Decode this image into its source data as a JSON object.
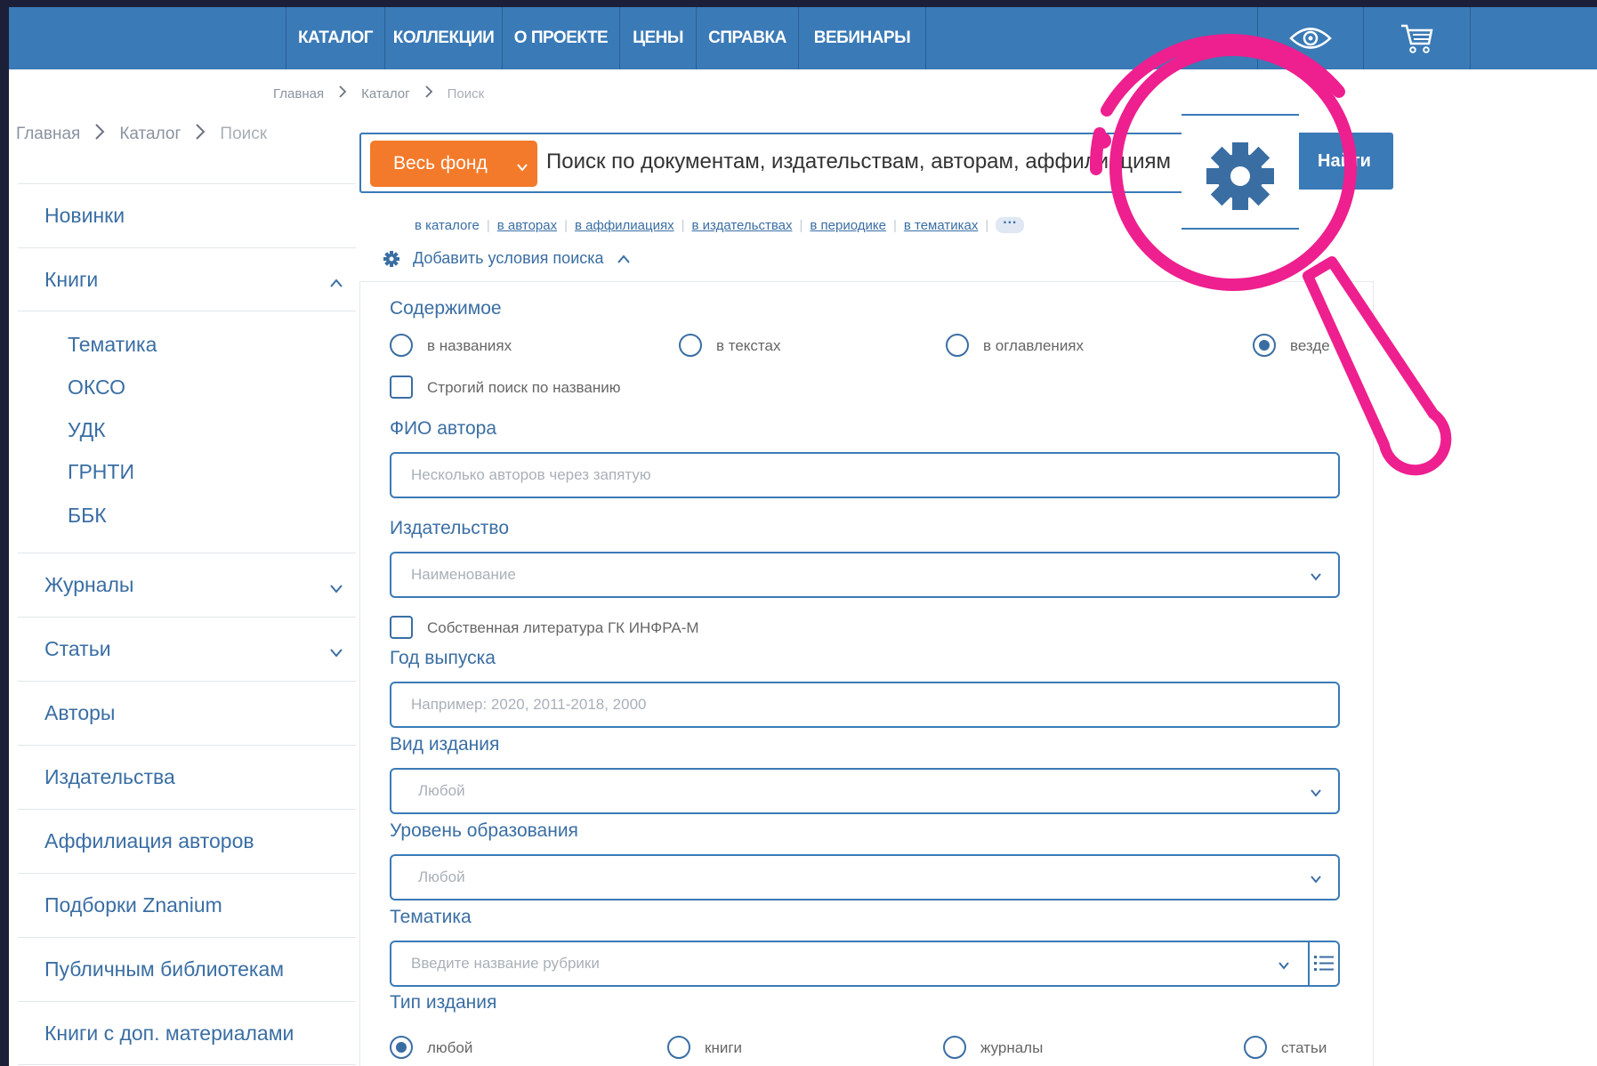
{
  "nav": {
    "items": [
      "КАТАЛОГ",
      "КОЛЛЕКЦИИ",
      "О ПРОЕКТЕ",
      "ЦЕНЫ",
      "СПРАВКА",
      "ВЕБИНАРЫ"
    ]
  },
  "breadcrumb_top": [
    "Главная",
    "Каталог",
    "Поиск"
  ],
  "breadcrumb_side": [
    "Главная",
    "Каталог",
    "Поиск"
  ],
  "sidebar": {
    "items": [
      "Новинки",
      "Книги",
      "Журналы",
      "Статьи",
      "Авторы",
      "Издательства",
      "Аффилиация авторов",
      "Подборки Znanium",
      "Публичным библиотекам",
      "Книги с доп. материалами"
    ],
    "sub_items": [
      "Тематика",
      "ОКСО",
      "УДК",
      "ГРНТИ",
      "ББК"
    ]
  },
  "search": {
    "fund_label": "Весь фонд",
    "placeholder": "Поиск по документам, издательствам, авторам, аффилиациям",
    "find_label": "Найти",
    "scopes": [
      "в каталоге",
      "в авторах",
      "в аффилиациях",
      "в издательствах",
      "в периодике",
      "в тематиках"
    ],
    "more": "···",
    "add_conditions": "Добавить условия поиска"
  },
  "form": {
    "content_label": "Содержимое",
    "content_options": [
      "в названиях",
      "в текстах",
      "в оглавлениях",
      "везде"
    ],
    "strict_label": "Строгий поиск по названию",
    "author_label": "ФИО автора",
    "author_placeholder": "Несколько авторов через запятую",
    "publisher_label": "Издательство",
    "publisher_placeholder": "Наименование",
    "own_lit_label": "Собственная литература ГК ИНФРА-М",
    "year_label": "Год выпуска",
    "year_placeholder": "Например: 2020, 2011-2018, 2000",
    "edition_label": "Вид издания",
    "edition_value": "Любой",
    "level_label": "Уровень образования",
    "level_value": "Любой",
    "topic_label": "Тематика",
    "topic_placeholder": "Введите название рубрики",
    "type_label": "Тип издания",
    "type_options": [
      "любой",
      "книги",
      "журналы",
      "статьи"
    ]
  },
  "colors": {
    "nav_bg": "#3a7ab7",
    "accent_orange": "#f37a2a",
    "link_blue": "#3a6ea3",
    "magnifier": "#ee1f8f",
    "frame_bg": "#1c1f38"
  }
}
